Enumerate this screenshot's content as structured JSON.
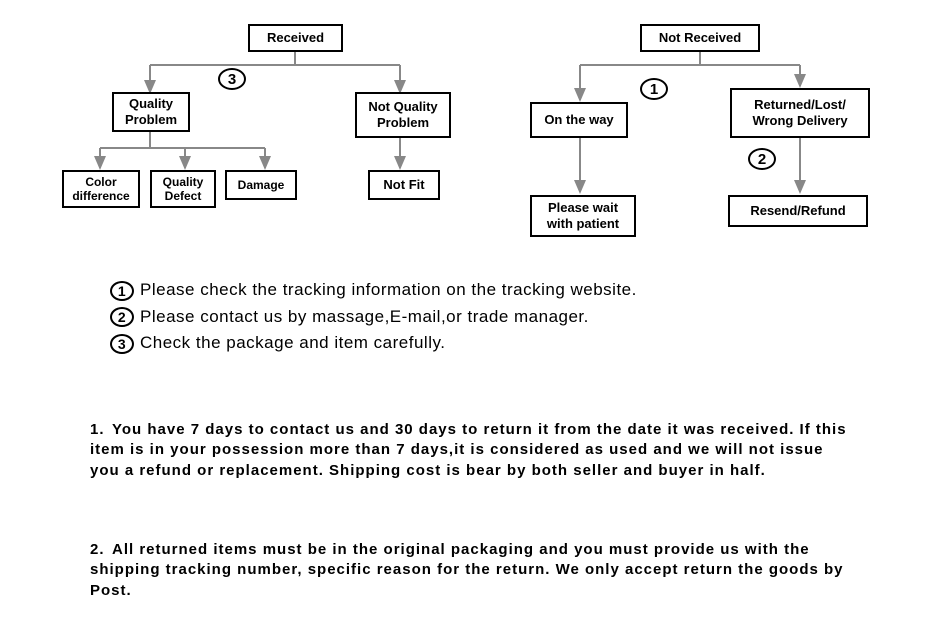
{
  "flowcharts": {
    "left": {
      "root": "Received",
      "badge_num": "3",
      "children": [
        {
          "label": "Quality\nProblem",
          "children": [
            "Color\ndifference",
            "Quality\nDefect",
            "Damage"
          ]
        },
        {
          "label": "Not Quality\nProblem",
          "children": [
            "Not Fit"
          ]
        }
      ]
    },
    "right": {
      "root": "Not  Received",
      "badges": [
        "1",
        "2"
      ],
      "children": [
        {
          "label": "On the way",
          "children": [
            "Please wait\nwith patient"
          ]
        },
        {
          "label": "Returned/Lost/\nWrong Delivery",
          "children": [
            "Resend/Refund"
          ]
        }
      ]
    }
  },
  "legend": [
    {
      "num": "1",
      "text": "Please check the tracking information on the tracking website."
    },
    {
      "num": "2",
      "text": "Please contact us by  massage,E-mail,or trade manager."
    },
    {
      "num": "3",
      "text": "Check the package and item carefully."
    }
  ],
  "policy": [
    "You have 7 days to contact us and 30 days to return it from the date it was received. If this item is in your possession more than 7 days,it is considered as used and we will not issue you a refund or replacement.  Shipping cost is bear by both seller and buyer in half.",
    "All returned items must be in the original packaging and you must provide us with the shipping tracking number, specific reason for the return. We only accept return the goods by Post."
  ]
}
